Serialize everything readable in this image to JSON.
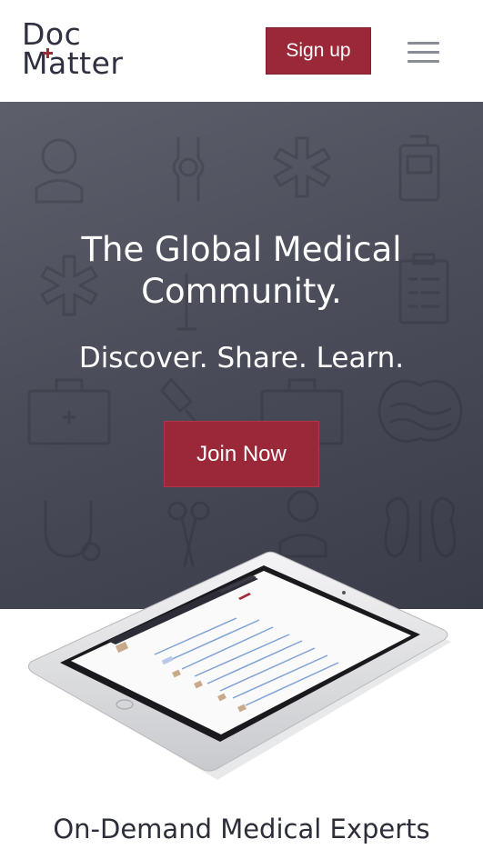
{
  "header": {
    "logo_line1": "Doc",
    "logo_line2": "Matter",
    "signup_label": "Sign up",
    "menu_icon": "hamburger-menu-icon"
  },
  "hero": {
    "title": "The Global Medical Community.",
    "subtitle": "Discover. Share. Learn.",
    "join_label": "Join Now"
  },
  "section": {
    "heading": "On-Demand Medical Experts"
  },
  "colors": {
    "brand": "#9b2838",
    "hero_bg": "#4b4d5a",
    "logo_text": "#2f3140"
  }
}
